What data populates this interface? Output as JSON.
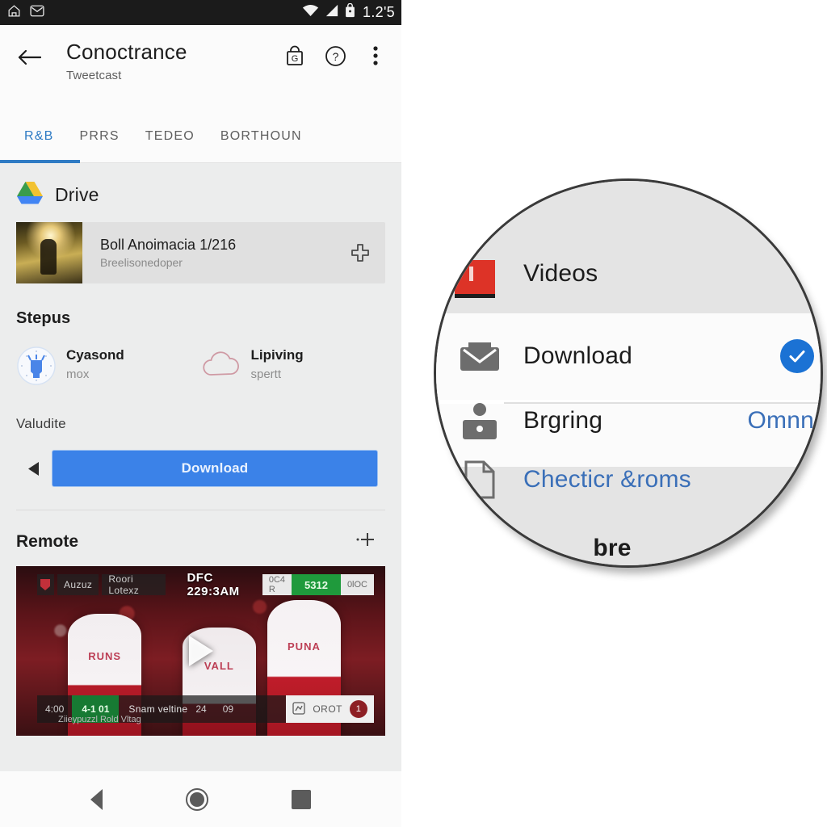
{
  "statusbar": {
    "left_icons": [
      "home-outline-icon",
      "message-outline-icon"
    ],
    "right_icons": [
      "wifi-icon",
      "cellular-signal-icon",
      "battery-lock-icon"
    ],
    "time": "1.2'5"
  },
  "appbar": {
    "back_icon": "back-arrow-icon",
    "title": "Conoctrance",
    "subtitle": "Tweetcast",
    "actions": [
      {
        "name": "lock-g-icon",
        "label": "G"
      },
      {
        "name": "help-circle-icon",
        "label": "?"
      },
      {
        "name": "overflow-menu-icon",
        "label": "⋮"
      }
    ]
  },
  "tabs": {
    "items": [
      {
        "label": "R&B",
        "active": true
      },
      {
        "label": "PRRS",
        "active": false
      },
      {
        "label": "TEDEO",
        "active": false
      },
      {
        "label": "BORTHOUN",
        "active": false
      }
    ],
    "accent_color": "#2f7bc4"
  },
  "drive": {
    "logo_icon": "google-drive-icon",
    "label": "Drive",
    "file": {
      "thumbnail": "crowd-photo-thumbnail",
      "title": "Boll Anoimacia 1/216",
      "subtitle": "Breelisonedoper",
      "action_icon": "plus-cross-icon"
    }
  },
  "stepus": {
    "title": "Stepus",
    "items": [
      {
        "icon": "clock-badge-icon",
        "name": "Cyasond",
        "value": "mox"
      },
      {
        "icon": "cloud-outline-icon",
        "name": "Lipiving",
        "value": "spertt"
      }
    ],
    "validate_label": "Valudite",
    "caret_icon": "left-caret-icon",
    "download_label": "Download",
    "download_color": "#3b82e8"
  },
  "remote": {
    "title": "Remote",
    "add_icon": "add-plus-icon",
    "video": {
      "play_icon": "play-triangle-icon",
      "scoreboard": {
        "crest_icon": "team-crest-icon",
        "team_home": "Auzuz",
        "team_away": "Roori Lotexz",
        "headline": "DFC 229:3AM",
        "clock_left": "0C4 R",
        "clock_center": "5312",
        "clock_right": "0lOC"
      },
      "lowerbar": {
        "num_left": "4:00",
        "score": "4-1 01",
        "title": "Snam veltine",
        "n1": "24",
        "n2": "09",
        "chip_icon": "stats-chip-icon",
        "chip_label": "OROT",
        "badge": "1",
        "caption": "Ziieypuzzl Rold Vltag"
      }
    }
  },
  "navbar": {
    "back_icon": "nav-back-icon",
    "home_icon": "nav-home-icon",
    "recents_icon": "nav-recents-icon"
  },
  "magnifier": {
    "rows": [
      {
        "icon": "red-file-icon",
        "label": "Videos",
        "right": "",
        "style": "grey"
      },
      {
        "icon": "download-tray-icon",
        "label": "Download",
        "right": "check-circle-icon",
        "style": "white"
      },
      {
        "icon": "person-box-icon",
        "label": "Brgring",
        "right": "Omnn",
        "style": "white"
      },
      {
        "icon": "document-outline-icon",
        "label": "Checticr &roms",
        "right": "",
        "style": "grey"
      },
      {
        "icon": "",
        "label": "bre",
        "right": "",
        "style": "grey"
      }
    ],
    "check_color": "#1b72d4",
    "link_color": "#3a6fb8"
  }
}
